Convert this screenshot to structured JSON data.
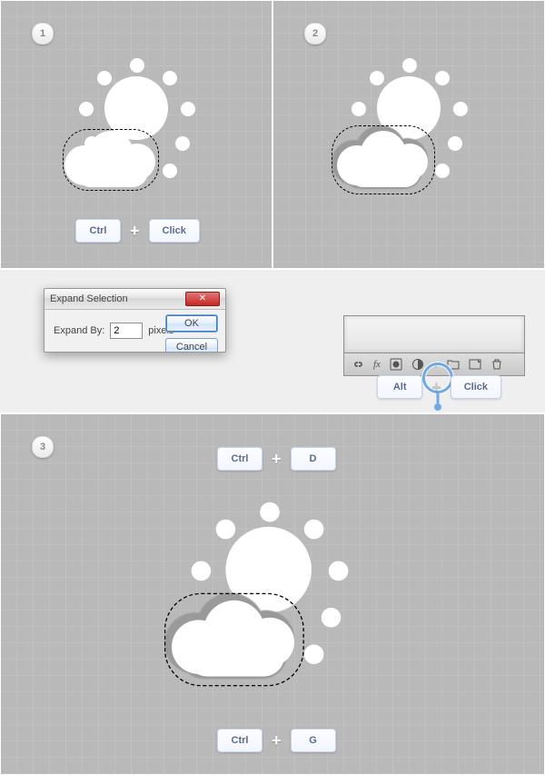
{
  "steps": {
    "s1": "1",
    "s2": "2",
    "s3": "3"
  },
  "keys": {
    "ctrl": "Ctrl",
    "alt": "Alt",
    "click": "Click",
    "d": "D",
    "g": "G",
    "plus": "+"
  },
  "dialog": {
    "title": "Expand Selection",
    "field_label": "Expand By:",
    "value": "2",
    "unit": "pixels",
    "ok": "OK",
    "cancel": "Cancel"
  },
  "layers_icons": {
    "link": "link-icon",
    "fx": "fx",
    "mask": "mask-icon",
    "adjust": "adjustment-icon",
    "group": "group-icon",
    "new": "new-layer-icon",
    "trash": "trash-icon"
  }
}
